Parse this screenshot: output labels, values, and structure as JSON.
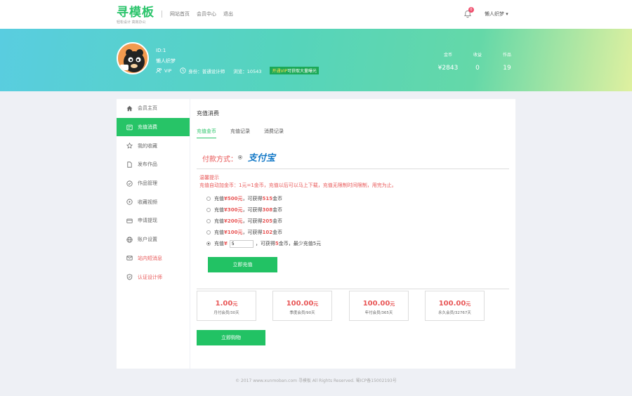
{
  "header": {
    "logo_text": "寻模板",
    "logo_subtitle": "轻松设计 高效办公",
    "nav": [
      "网站首页",
      "会员中心",
      "退出"
    ],
    "notification_count": "0",
    "user_menu": "懒人织梦"
  },
  "profile": {
    "id": "ID:1",
    "name": "懒人织梦",
    "vip": "VIP",
    "identity": "身份：普通设计师",
    "views": "浏览：10543",
    "vip_promo_highlight": "开通VIP",
    "vip_promo_rest": "可获取大量曝光",
    "stats": [
      {
        "label": "金币",
        "value": "¥2843"
      },
      {
        "label": "收益",
        "value": "0"
      },
      {
        "label": "作品",
        "value": "19"
      }
    ],
    "brand_color": "#27c467"
  },
  "sidebar": {
    "items": [
      {
        "label": "会员主页",
        "icon": "home-icon"
      },
      {
        "label": "充值消费",
        "icon": "wallet-icon"
      },
      {
        "label": "我的收藏",
        "icon": "star-icon"
      },
      {
        "label": "发布作品",
        "icon": "document-icon"
      },
      {
        "label": "作品管理",
        "icon": "circle-check-icon"
      },
      {
        "label": "收藏视频",
        "icon": "play-icon"
      },
      {
        "label": "申请提现",
        "icon": "cash-icon"
      },
      {
        "label": "账户设置",
        "icon": "globe-icon"
      },
      {
        "label": "站内短消息",
        "icon": "mail-icon"
      },
      {
        "label": "认证设计师",
        "icon": "shield-icon"
      }
    ]
  },
  "main": {
    "title": "充值消费",
    "tabs": [
      "充值金币",
      "充值记录",
      "消费记录"
    ],
    "pay_method_label": "付款方式：",
    "pay_method_value": "支付宝",
    "tip_title": "温馨提示",
    "tip_text": "充值自动加金币：1元=1金币，充值以后可以马上下载，充值无限制时间限制，用完为止。",
    "options": [
      {
        "pre": "充值 ",
        "amount": "¥500元",
        "mid": "，可获得 ",
        "coins": "515",
        "post": " 金币"
      },
      {
        "pre": "充值 ",
        "amount": "¥300元",
        "mid": "，可获得 ",
        "coins": "308",
        "post": " 金币"
      },
      {
        "pre": "充值 ",
        "amount": "¥200元",
        "mid": "，可获得 ",
        "coins": "205",
        "post": " 金币"
      },
      {
        "pre": "充值 ",
        "amount": "¥100元",
        "mid": "，可获得 ",
        "coins": "102",
        "post": " 金币"
      }
    ],
    "custom": {
      "pre": "充值 ",
      "currency": "¥",
      "input_value": "5",
      "mid": "，可获得 ",
      "coins": "5",
      "post": " 金币，最少充值5元"
    },
    "recharge_button": "立即充值",
    "plans": [
      {
        "price": "1.00",
        "unit": "元",
        "desc": "月付会员/30天"
      },
      {
        "price": "100.00",
        "unit": "元",
        "desc": "季度会员/90天"
      },
      {
        "price": "100.00",
        "unit": "元",
        "desc": "年付会员/365天"
      },
      {
        "price": "100.00",
        "unit": "元",
        "desc": "永久会员/32767天"
      }
    ],
    "buy_button": "立即购物"
  },
  "footer": {
    "text": "© 2017 www.xunmoban.com 寻模板 All Rights Reserved. 蜀ICP备15002193号"
  }
}
